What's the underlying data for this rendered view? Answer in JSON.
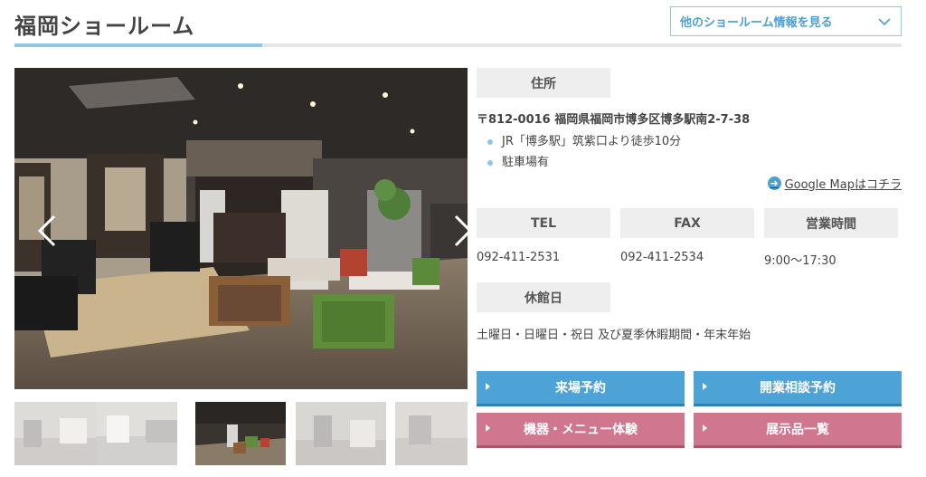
{
  "header": {
    "title": "福岡ショールーム",
    "dropdown_label": "他のショールーム情報を見る"
  },
  "gallery": {
    "main_photo": "showroom-photo",
    "thumbnail_count": 5,
    "active_thumbnail": 3
  },
  "info": {
    "address_label": "住所",
    "address": "〒812-0016 福岡県福岡市博多区博多駅南2-7-38",
    "access": [
      "JR「博多駅」筑紫口より徒歩10分",
      "駐車場有"
    ],
    "map_link": "Google Mapはコチラ",
    "tel_label": "TEL",
    "tel": "092-411-2531",
    "fax_label": "FAX",
    "fax": "092-411-2534",
    "hours_label": "営業時間",
    "hours": "9:00〜17:30",
    "closed_label": "休館日",
    "closed": "土曜日・日曜日・祝日 及び夏季休暇期間・年末年始"
  },
  "buttons": {
    "visit_reservation": "来場予約",
    "consultation_reservation": "開業相談予約",
    "equipment_experience": "機器・メニュー体験",
    "exhibit_list": "展示品一覧"
  },
  "colors": {
    "accent_blue": "#4da3d6",
    "accent_pink": "#d0768f",
    "rule_blue": "#8dc6e8",
    "label_gray": "#eeeeee"
  }
}
